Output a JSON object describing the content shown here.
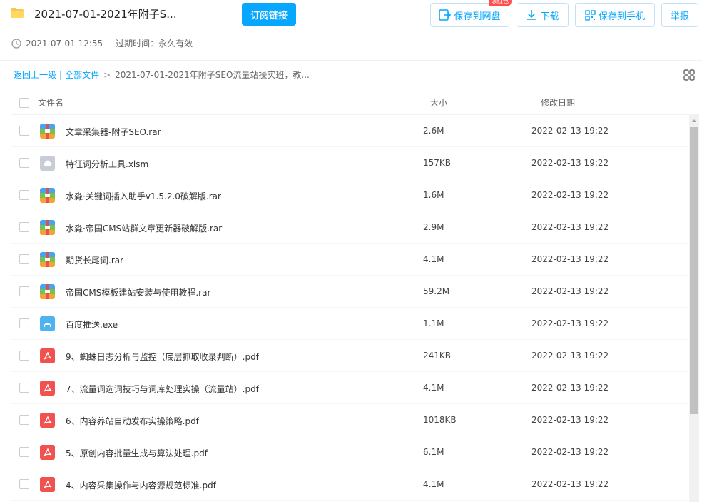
{
  "header": {
    "title": "2021-07-01-2021年附子S...",
    "subscribe_label": "订阅链接",
    "save_disk_label": "保存到网盘",
    "badge_label": "领红包",
    "download_label": "下载",
    "save_phone_label": "保存到手机",
    "report_label": "举报",
    "accent_color": "#06a7ff"
  },
  "meta": {
    "share_time": "2021-07-01 12:55",
    "expire_text": "过期时间：永久有效"
  },
  "breadcrumb": {
    "back": "返回上一级",
    "sep": "|",
    "all_files": "全部文件",
    "arrow": ">",
    "current": "2021-07-01-2021年附子SEO流量站操实班，教..."
  },
  "columns": {
    "name": "文件名",
    "size": "大小",
    "date": "修改日期"
  },
  "files": [
    {
      "name": "文章采集器-附子SEO.rar",
      "size": "2.6M",
      "date": "2022-02-13 19:22",
      "icon": "rar-archive-icon"
    },
    {
      "name": "特征词分析工具.xlsm",
      "size": "157KB",
      "date": "2022-02-13 19:22",
      "icon": "cloud-file-icon"
    },
    {
      "name": "水淼·关键词插入助手v1.5.2.0破解版.rar",
      "size": "1.6M",
      "date": "2022-02-13 19:22",
      "icon": "rar-archive-icon"
    },
    {
      "name": "水淼·帝国CMS站群文章更新器破解版.rar",
      "size": "2.9M",
      "date": "2022-02-13 19:22",
      "icon": "rar-archive-icon"
    },
    {
      "name": "期货长尾词.rar",
      "size": "4.1M",
      "date": "2022-02-13 19:22",
      "icon": "rar-archive-icon"
    },
    {
      "name": "帝国CMS模板建站安装与使用教程.rar",
      "size": "59.2M",
      "date": "2022-02-13 19:22",
      "icon": "rar-archive-icon"
    },
    {
      "name": "百度推送.exe",
      "size": "1.1M",
      "date": "2022-02-13 19:22",
      "icon": "exe-file-icon"
    },
    {
      "name": "9、蜘蛛日志分析与监控（底层抓取收录判断）.pdf",
      "size": "241KB",
      "date": "2022-02-13 19:22",
      "icon": "pdf-file-icon"
    },
    {
      "name": "7、流量词选词技巧与词库处理实操（流量站）.pdf",
      "size": "4.1M",
      "date": "2022-02-13 19:22",
      "icon": "pdf-file-icon"
    },
    {
      "name": "6、内容养站自动发布实操策略.pdf",
      "size": "1018KB",
      "date": "2022-02-13 19:22",
      "icon": "pdf-file-icon"
    },
    {
      "name": "5、原创内容批量生成与算法处理.pdf",
      "size": "6.1M",
      "date": "2022-02-13 19:22",
      "icon": "pdf-file-icon"
    },
    {
      "name": "4、内容采集操作与内容源规范标准.pdf",
      "size": "4.1M",
      "date": "2022-02-13 19:22",
      "icon": "pdf-file-icon"
    }
  ]
}
